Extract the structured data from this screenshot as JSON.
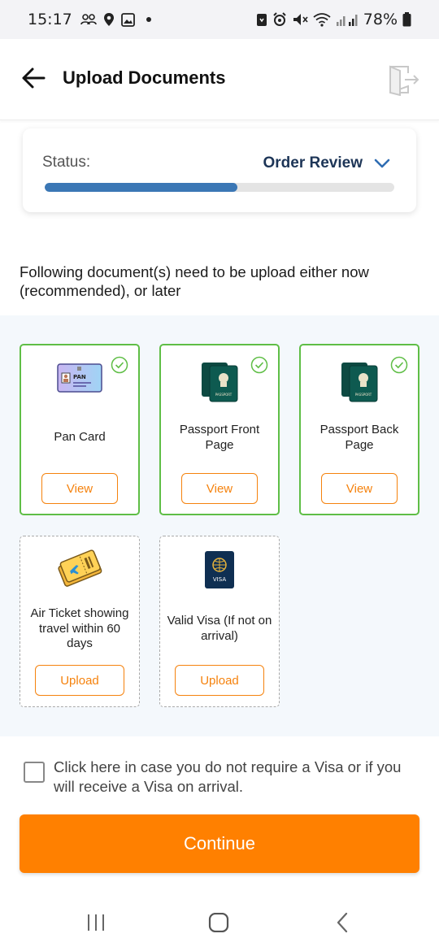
{
  "status_bar": {
    "time": "15:17",
    "battery_text": "78%"
  },
  "header": {
    "title": "Upload Documents"
  },
  "status_card": {
    "label": "Status:",
    "value": "Order Review",
    "progress_fraction": 0.55
  },
  "instructions": "Following document(s) need to be upload either now (recommended), or later",
  "documents": [
    {
      "label": "Pan Card",
      "button": "View",
      "state": "uploaded",
      "icon": "pan-card-icon",
      "image_text": "PAN"
    },
    {
      "label": "Passport Front Page",
      "button": "View",
      "state": "uploaded",
      "icon": "passport-icon",
      "image_text": "PASSPORT"
    },
    {
      "label": "Passport Back Page",
      "button": "View",
      "state": "uploaded",
      "icon": "passport-icon",
      "image_text": "PASSPORT"
    },
    {
      "label": "Air Ticket showing travel within 60 days",
      "button": "Upload",
      "state": "pending",
      "icon": "air-ticket-icon"
    },
    {
      "label": "Valid Visa  (If not on arrival)",
      "button": "Upload",
      "state": "pending",
      "icon": "visa-icon",
      "image_text": "VISA"
    }
  ],
  "visa_checkbox": {
    "label": "Click here in case you do not require a Visa or if you will receive a Visa on arrival.",
    "checked": false
  },
  "continue_button": "Continue",
  "colors": {
    "accent": "#ff8000",
    "primary_text": "#1d3557",
    "progress": "#3b77b5",
    "success": "#5fbe46",
    "docs_background": "#f4f8fc"
  }
}
